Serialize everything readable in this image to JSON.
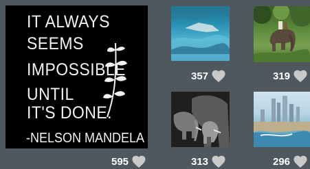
{
  "quote_card": {
    "lines": [
      "IT ALWAYS",
      "SEEMS",
      "IMPOSSIBLE",
      "UNTIL",
      "IT'S DONE."
    ],
    "author": "-NELSON MANDELA"
  },
  "tiles": [
    {
      "subject": "water-tile",
      "likes": "357"
    },
    {
      "subject": "jungle-elephant-ride",
      "likes": "319"
    },
    {
      "subject": "quote-card",
      "likes": "595"
    },
    {
      "subject": "elephant-herd",
      "likes": "313"
    },
    {
      "subject": "harbor-city",
      "likes": "296"
    }
  ],
  "icons": {
    "like": "heart-icon"
  },
  "colors": {
    "background": "#4f575f",
    "heart": "#c9c9c9",
    "count_text": "#ffffff"
  }
}
